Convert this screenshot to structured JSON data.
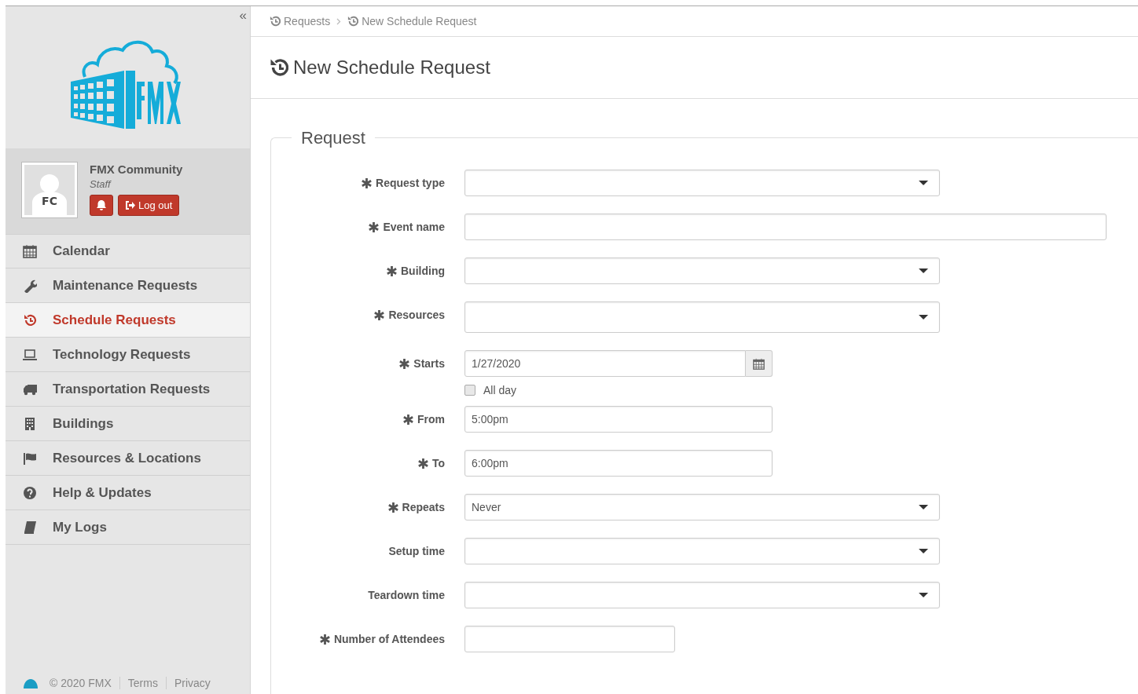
{
  "sidebar": {
    "collapse_glyph": "«",
    "user": {
      "initials": "FC",
      "name": "FMX Community",
      "role": "Staff",
      "logout": "Log out"
    },
    "items": [
      {
        "label": "Calendar",
        "selected": false
      },
      {
        "label": "Maintenance Requests",
        "selected": false
      },
      {
        "label": "Schedule Requests",
        "selected": true
      },
      {
        "label": "Technology Requests",
        "selected": false
      },
      {
        "label": "Transportation Requests",
        "selected": false
      },
      {
        "label": "Buildings",
        "selected": false
      },
      {
        "label": "Resources & Locations",
        "selected": false
      },
      {
        "label": "Help & Updates",
        "selected": false
      },
      {
        "label": "My Logs",
        "selected": false
      }
    ],
    "footer": {
      "copyright": "© 2020 FMX",
      "links": [
        "Terms",
        "Privacy"
      ]
    }
  },
  "breadcrumb": [
    "Requests",
    "New Schedule Request"
  ],
  "page_title": "New Schedule Request",
  "section": {
    "legend": "Request",
    "fields": [
      {
        "label": "Request type",
        "required": true,
        "kind": "select"
      },
      {
        "label": "Event name",
        "required": true,
        "kind": "text"
      },
      {
        "label": "Building",
        "required": true,
        "kind": "select"
      },
      {
        "label": "Resources",
        "required": true,
        "kind": "multiselect"
      },
      {
        "label": "Starts",
        "required": true,
        "kind": "date",
        "value": "1/27/2020",
        "option": {
          "label": "All day",
          "checked": false
        }
      },
      {
        "label": "From",
        "required": true,
        "kind": "time",
        "value": "5:00pm"
      },
      {
        "label": "To",
        "required": true,
        "kind": "time",
        "value": "6:00pm"
      },
      {
        "label": "Repeats",
        "required": true,
        "kind": "select",
        "value": "Never"
      },
      {
        "label": "Setup time",
        "required": false,
        "kind": "select"
      },
      {
        "label": "Teardown time",
        "required": false,
        "kind": "select"
      },
      {
        "label": "Number of Attendees",
        "required": true,
        "kind": "number"
      }
    ]
  }
}
